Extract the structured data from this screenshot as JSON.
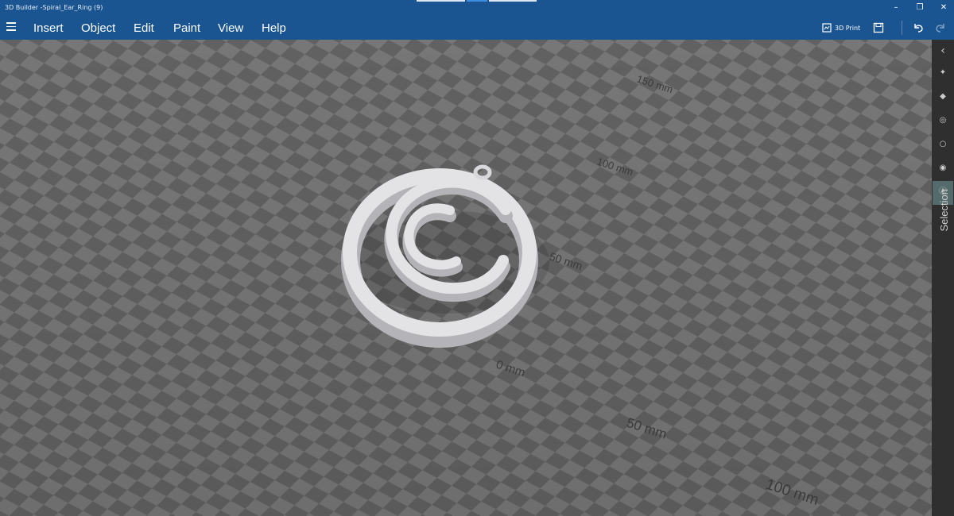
{
  "window": {
    "title": "3D Builder -Spiral_Ear_Ring (9)",
    "controls": [
      "minimize-icon",
      "restore-icon",
      "close-icon"
    ]
  },
  "menu": {
    "items": [
      "Insert",
      "Object",
      "Edit",
      "Paint",
      "View",
      "Help"
    ],
    "toolbar": {
      "print_label": "3D Print",
      "save_icon": "save-icon",
      "undo_icon": "undo-icon",
      "redo_icon": "redo-icon"
    }
  },
  "scene": {
    "ruler_labels": [
      "150 mm",
      "100 mm",
      "50 mm",
      "0 mm",
      "50 mm",
      "100 mm"
    ],
    "object": "spiral earring"
  },
  "right_panel": {
    "label": "Selection",
    "icons": [
      "chevron-left-icon",
      "select-objects-icon",
      "select-faces-icon",
      "select-edges-icon",
      "select-vertices-icon",
      "select-mode-icon",
      "selection-icon"
    ]
  },
  "colors": {
    "title_bar": "#1a5591",
    "floor_dark": "#666666",
    "floor_light": "#7d7d7d",
    "object": "#e3e3e6",
    "side_panel": "#2f2f2f",
    "active_tool": "#556b6b"
  }
}
